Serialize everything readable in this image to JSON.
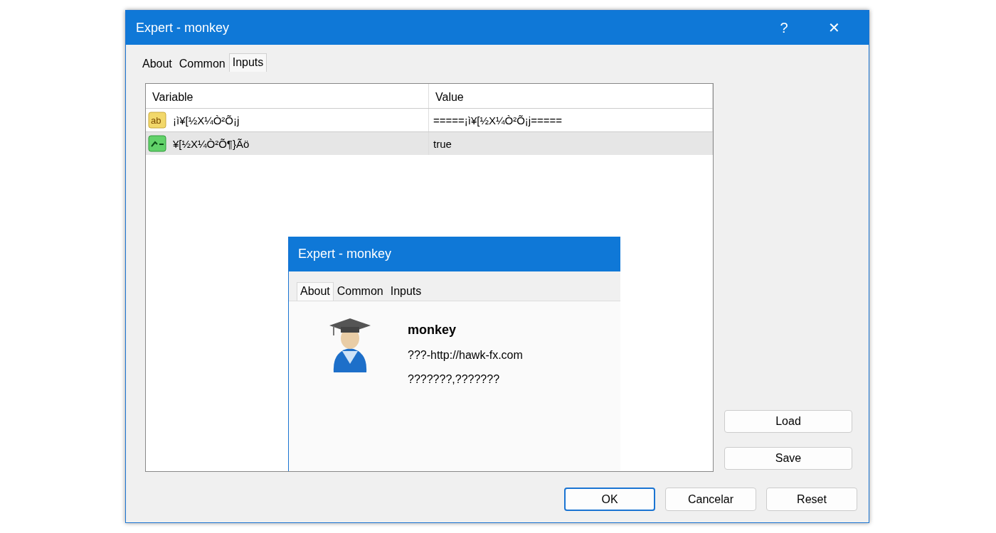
{
  "window": {
    "title": "Expert - monkey",
    "help": "?",
    "close": "✕"
  },
  "tabs": [
    {
      "label": "About",
      "selected": false
    },
    {
      "label": "Common",
      "selected": false
    },
    {
      "label": "Inputs",
      "selected": true
    }
  ],
  "table": {
    "columns": [
      "Variable",
      "Value"
    ],
    "rows": [
      {
        "kind": "text",
        "icon_label": "ab",
        "variable": "¡ì¥[½X¼Ò²Õ¡j",
        "value": "=====¡ì¥[½X¼Ò²Õ¡j=====",
        "selected": false
      },
      {
        "kind": "bool",
        "variable": "¥[½X¼Ò²Õ¶}Ãö",
        "value": "true",
        "selected": true
      }
    ]
  },
  "inset": {
    "title": "Expert - monkey",
    "tabs": [
      {
        "label": "About",
        "selected": true
      },
      {
        "label": "Common",
        "selected": false
      },
      {
        "label": "Inputs",
        "selected": false
      }
    ],
    "name": "monkey",
    "link": "???-http://hawk-fx.com",
    "copyright": "???????,???????"
  },
  "side_buttons": [
    "Load",
    "Save"
  ],
  "buttons": [
    {
      "label": "OK",
      "default": true
    },
    {
      "label": "Cancelar",
      "default": false
    },
    {
      "label": "Reset",
      "default": false
    }
  ]
}
